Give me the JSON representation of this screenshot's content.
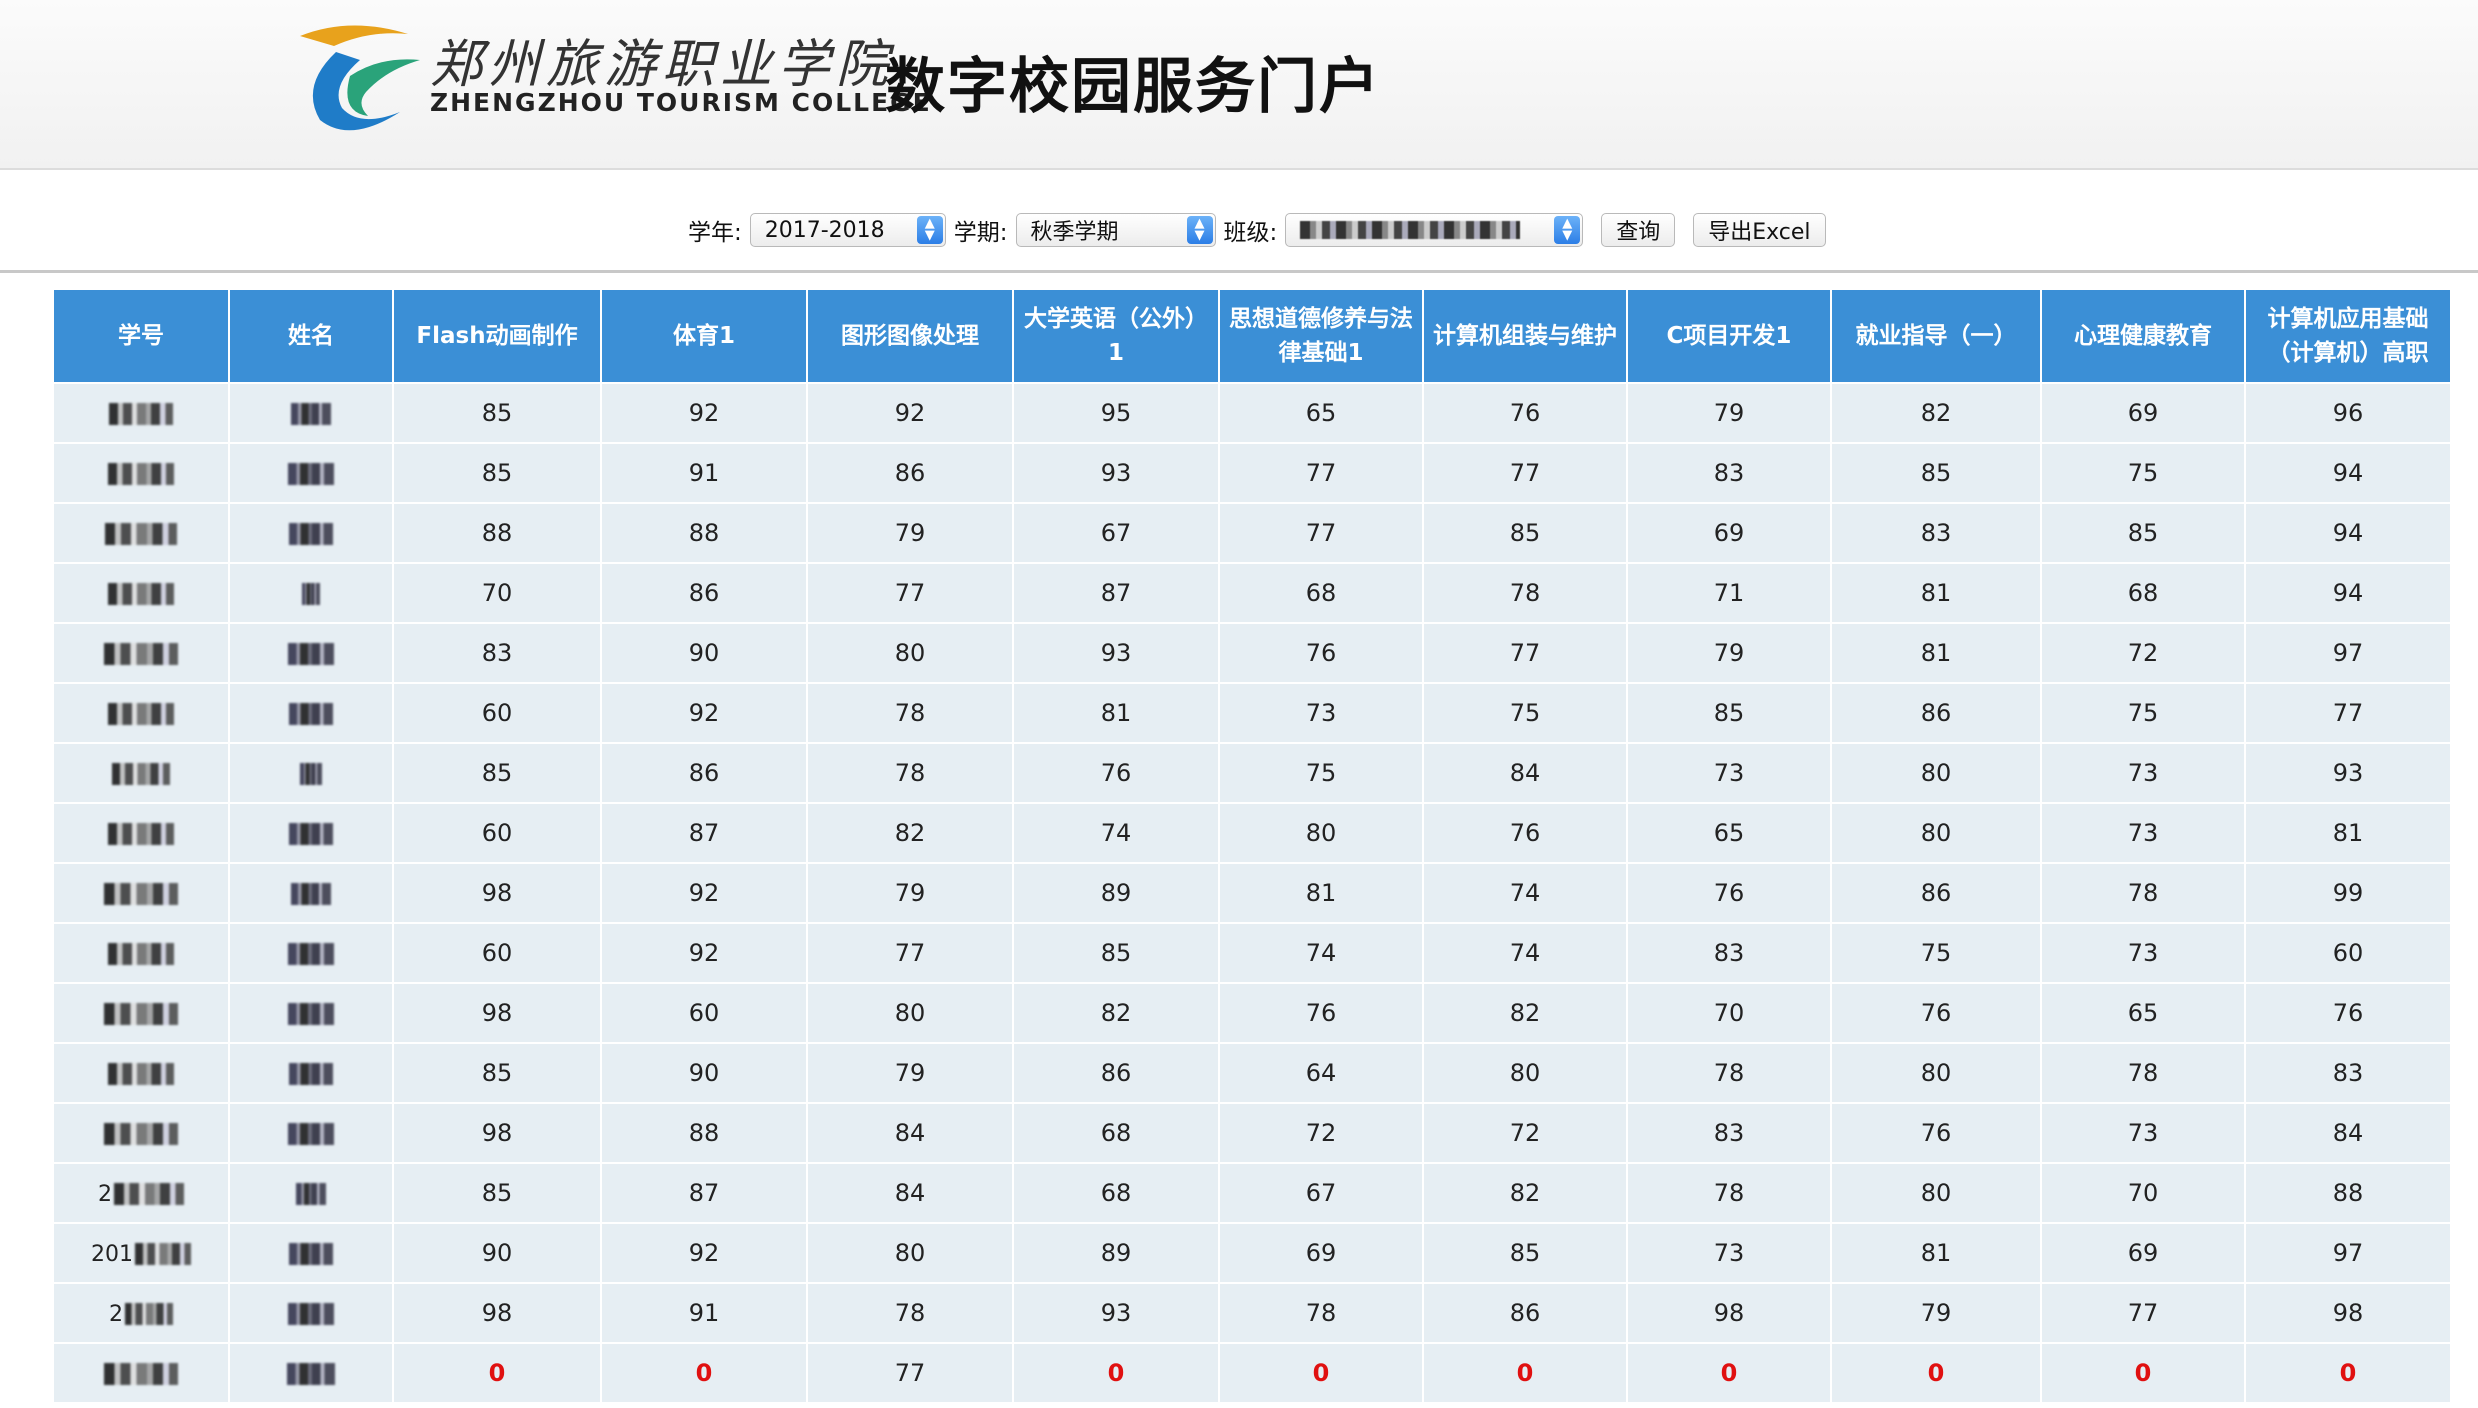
{
  "header": {
    "school_name_cn": "郑州旅游职业学院",
    "school_name_en": "ZHENGZHOU TOURISM COLLEGE",
    "portal_title": "数字校园服务门户",
    "logo_icon": "college-logo-swoosh"
  },
  "filters": {
    "year_label": "学年:",
    "year_value": "2017-2018",
    "term_label": "学期:",
    "term_value": "秋季学期",
    "class_label": "班级:",
    "query_button": "查询",
    "export_button": "导出Excel"
  },
  "table": {
    "columns": [
      "学号",
      "姓名",
      "Flash动画制作",
      "体育1",
      "图形图像处理",
      "大学英语（公外）1",
      "思想道德修养与法律基础1",
      "计算机组装与维护",
      "C项目开发1",
      "就业指导（一）",
      "心理健康教育",
      "计算机应用基础（计算机）高职"
    ],
    "rows": [
      {
        "id_prefix": "",
        "scores": [
          "85",
          "92",
          "92",
          "95",
          "65",
          "76",
          "79",
          "82",
          "69",
          "96"
        ]
      },
      {
        "id_prefix": "",
        "scores": [
          "85",
          "91",
          "86",
          "93",
          "77",
          "77",
          "83",
          "85",
          "75",
          "94"
        ]
      },
      {
        "id_prefix": "",
        "scores": [
          "88",
          "88",
          "79",
          "67",
          "77",
          "85",
          "69",
          "83",
          "85",
          "94"
        ]
      },
      {
        "id_prefix": "",
        "scores": [
          "70",
          "86",
          "77",
          "87",
          "68",
          "78",
          "71",
          "81",
          "68",
          "94"
        ]
      },
      {
        "id_prefix": "",
        "scores": [
          "83",
          "90",
          "80",
          "93",
          "76",
          "77",
          "79",
          "81",
          "72",
          "97"
        ]
      },
      {
        "id_prefix": "",
        "scores": [
          "60",
          "92",
          "78",
          "81",
          "73",
          "75",
          "85",
          "86",
          "75",
          "77"
        ]
      },
      {
        "id_prefix": "",
        "scores": [
          "85",
          "86",
          "78",
          "76",
          "75",
          "84",
          "73",
          "80",
          "73",
          "93"
        ]
      },
      {
        "id_prefix": "",
        "scores": [
          "60",
          "87",
          "82",
          "74",
          "80",
          "76",
          "65",
          "80",
          "73",
          "81"
        ]
      },
      {
        "id_prefix": "",
        "scores": [
          "98",
          "92",
          "79",
          "89",
          "81",
          "74",
          "76",
          "86",
          "78",
          "99"
        ]
      },
      {
        "id_prefix": "",
        "scores": [
          "60",
          "92",
          "77",
          "85",
          "74",
          "74",
          "83",
          "75",
          "73",
          "60"
        ]
      },
      {
        "id_prefix": "",
        "scores": [
          "98",
          "60",
          "80",
          "82",
          "76",
          "82",
          "70",
          "76",
          "65",
          "76"
        ]
      },
      {
        "id_prefix": "",
        "scores": [
          "85",
          "90",
          "79",
          "86",
          "64",
          "80",
          "78",
          "80",
          "78",
          "83"
        ]
      },
      {
        "id_prefix": "",
        "scores": [
          "98",
          "88",
          "84",
          "68",
          "72",
          "72",
          "83",
          "76",
          "73",
          "84"
        ]
      },
      {
        "id_prefix": "2",
        "scores": [
          "85",
          "87",
          "84",
          "68",
          "67",
          "82",
          "78",
          "80",
          "70",
          "88"
        ]
      },
      {
        "id_prefix": "201",
        "scores": [
          "90",
          "92",
          "80",
          "89",
          "69",
          "85",
          "73",
          "81",
          "69",
          "97"
        ]
      },
      {
        "id_prefix": "2",
        "scores": [
          "98",
          "91",
          "78",
          "93",
          "78",
          "86",
          "98",
          "79",
          "77",
          "98"
        ]
      },
      {
        "id_prefix": "",
        "scores": [
          "0",
          "0",
          "77",
          "0",
          "0",
          "0",
          "0",
          "0",
          "0",
          "0"
        ]
      }
    ]
  },
  "colors": {
    "header_blue": "#3b8fd6",
    "row_bg": "#e6eef3",
    "zero_red": "#e01010"
  }
}
